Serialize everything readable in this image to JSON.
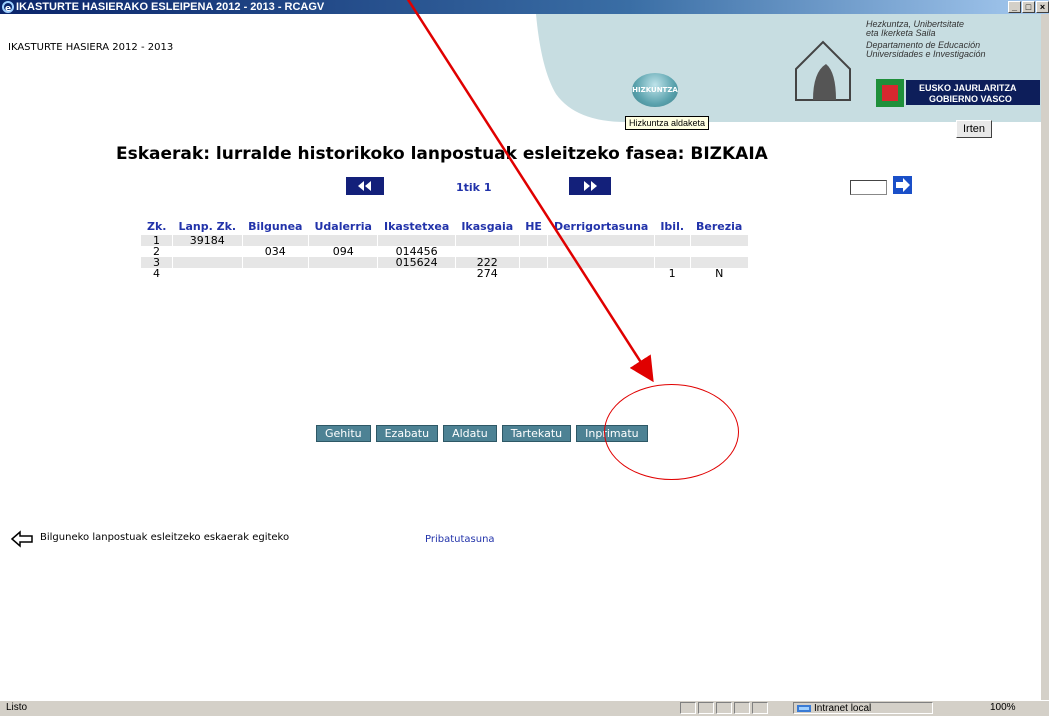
{
  "window": {
    "title": "IKASTURTE HASIERAKO ESLEIPENA 2012 - 2013 - RCAGV"
  },
  "header": {
    "school_year": "IKASTURTE HASIERA 2012 - 2013",
    "dept_eu": [
      "Hezkuntza, Unibertsitate",
      "eta Ikerketa Saila"
    ],
    "dept_es": [
      "Departamento de Educación",
      "Universidades e Investigación"
    ],
    "gov": [
      "EUSKO JAURLARITZA",
      "GOBIERNO VASCO"
    ],
    "lang_button": "HIZKUNTZA",
    "lang_tooltip": "Hizkuntza aldaketa",
    "exit_button": "Irten"
  },
  "main": {
    "title": "Eskaerak: lurralde historikoko lanpostuak esleitzeko fasea: BIZKAIA",
    "page_info": "1tik 1",
    "goto_value": ""
  },
  "table": {
    "headers": [
      "Zk.",
      "Lanp. Zk.",
      "Bilgunea",
      "Udalerria",
      "Ikastetxea",
      "Ikasgaia",
      "HE",
      "Derrigortasuna",
      "Ibil.",
      "Berezia"
    ],
    "rows": [
      [
        "1",
        "39184",
        "",
        "",
        "",
        "",
        "",
        "",
        "",
        ""
      ],
      [
        "2",
        "",
        "034",
        "094",
        "014456",
        "",
        "",
        "",
        "",
        ""
      ],
      [
        "3",
        "",
        "",
        "",
        "015624",
        "222",
        "",
        "",
        "",
        ""
      ],
      [
        "4",
        "",
        "",
        "",
        "",
        "274",
        "",
        "",
        "1",
        "N"
      ]
    ]
  },
  "actions": [
    "Gehitu",
    "Ezabatu",
    "Aldatu",
    "Tartekatu",
    "Inprimatu"
  ],
  "footer": {
    "back_link": "Bilguneko lanpostuak esleitzeko eskaerak egiteko",
    "privacy_link": "Pribatutasuna"
  },
  "status": {
    "text": "Listo",
    "zone": "Intranet local",
    "zoom": "100%"
  },
  "colors": {
    "nav_button": "#13207a",
    "link": "#2233aa",
    "action_button": "#4d8294",
    "annotation": "#e00000"
  },
  "icons": [
    "ie-icon",
    "rewind-icon",
    "fast-forward-icon",
    "go-arrow-icon",
    "back-arrow-icon",
    "intranet-icon",
    "annotation-arrow"
  ]
}
